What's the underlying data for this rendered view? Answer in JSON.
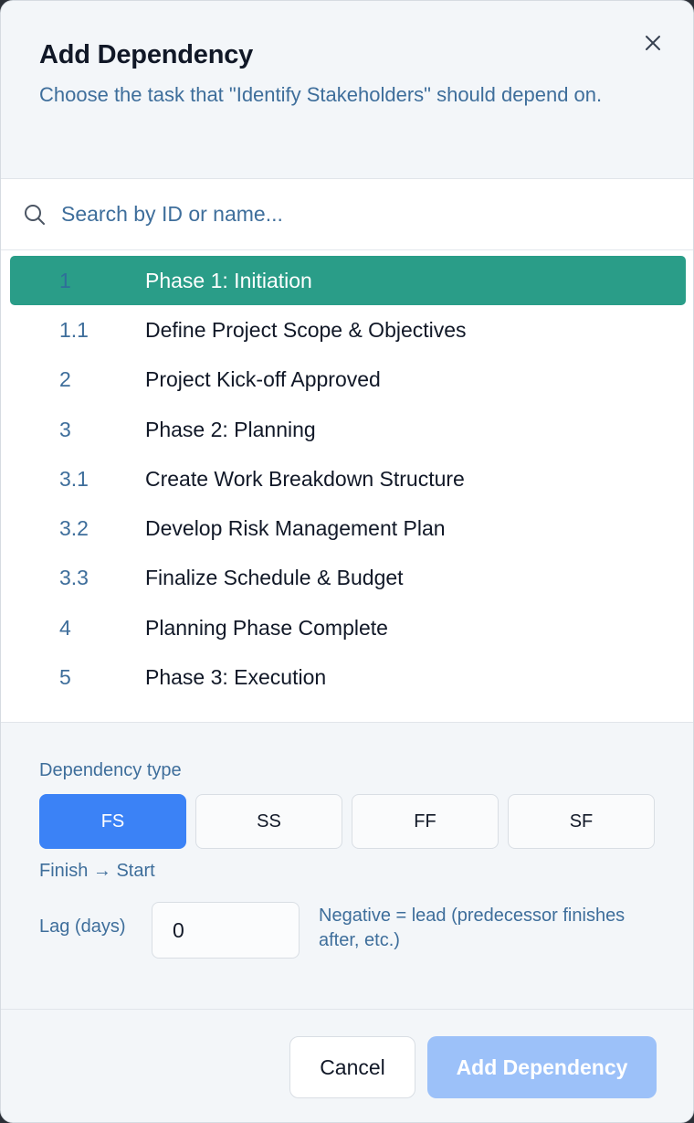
{
  "dialog": {
    "title": "Add Dependency",
    "subtitle": "Choose the task that \"Identify Stakeholders\" should depend on."
  },
  "search": {
    "placeholder": "Search by ID or name...",
    "value": ""
  },
  "tasks": [
    {
      "id": "1",
      "name": "Phase 1: Initiation",
      "selected": true
    },
    {
      "id": "1.1",
      "name": "Define Project Scope & Objectives"
    },
    {
      "id": "2",
      "name": "Project Kick-off Approved"
    },
    {
      "id": "3",
      "name": "Phase 2: Planning"
    },
    {
      "id": "3.1",
      "name": "Create Work Breakdown Structure"
    },
    {
      "id": "3.2",
      "name": "Develop Risk Management Plan"
    },
    {
      "id": "3.3",
      "name": "Finalize Schedule & Budget"
    },
    {
      "id": "4",
      "name": "Planning Phase Complete"
    },
    {
      "id": "5",
      "name": "Phase 3: Execution"
    }
  ],
  "dependency": {
    "label": "Dependency type",
    "types": [
      "FS",
      "SS",
      "FF",
      "SF"
    ],
    "selected": "FS",
    "description": "Finish → Start"
  },
  "lag": {
    "label": "Lag (days)",
    "value": "0",
    "hint": "Negative = lead (predecessor finishes after, etc.)"
  },
  "footer": {
    "cancel_label": "Cancel",
    "add_label": "Add Dependency"
  },
  "colors": {
    "selected_row": "#2a9d88",
    "active_type": "#3b82f6",
    "add_button_disabled": "#9cc1f9",
    "muted_text": "#3e6e9b"
  }
}
